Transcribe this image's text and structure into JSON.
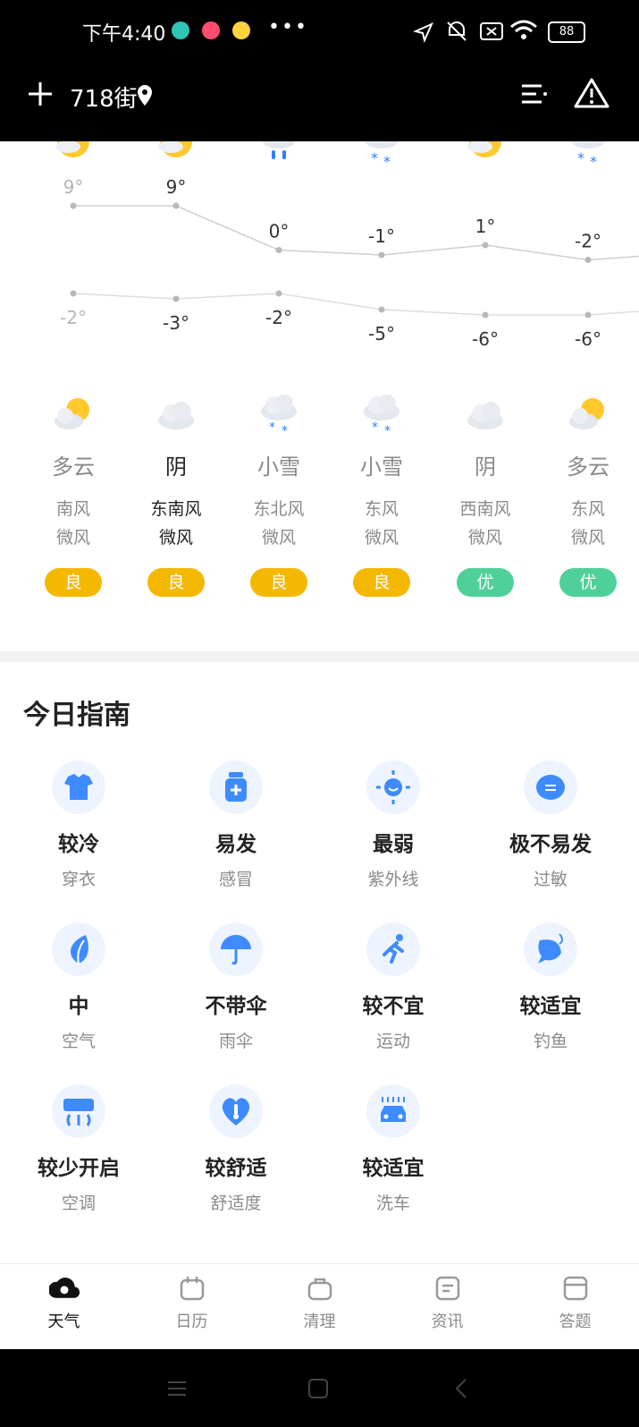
{
  "status_bar": {
    "time": "下午4:40",
    "battery": "88"
  },
  "header": {
    "city": "718街"
  },
  "chart_data": {
    "type": "line",
    "x": [
      "0",
      "1",
      "2",
      "3",
      "4",
      "5"
    ],
    "series": [
      {
        "values": [
          9,
          9,
          0,
          -1,
          1,
          -2
        ]
      },
      {
        "values": [
          -2,
          -3,
          -2,
          -5,
          -6,
          -6
        ]
      }
    ],
    "high_labels": [
      "9°",
      "9°",
      "0°",
      "-1°",
      "1°",
      "-2°"
    ],
    "low_labels": [
      "-2°",
      "-3°",
      "-2°",
      "-5°",
      "-6°",
      "-6°"
    ]
  },
  "days": [
    {
      "icon": "partly-cloudy-icon",
      "cond": "多云",
      "wind_dir": "南风",
      "wind_lvl": "微风",
      "aqi": "良",
      "aqi_color": "#f5b800"
    },
    {
      "icon": "cloudy-icon",
      "cond": "阴",
      "wind_dir": "东南风",
      "wind_lvl": "微风",
      "aqi": "良",
      "aqi_color": "#f5b800"
    },
    {
      "icon": "snow-icon",
      "cond": "小雪",
      "wind_dir": "东北风",
      "wind_lvl": "微风",
      "aqi": "良",
      "aqi_color": "#f5b800"
    },
    {
      "icon": "snow-icon",
      "cond": "小雪",
      "wind_dir": "东风",
      "wind_lvl": "微风",
      "aqi": "良",
      "aqi_color": "#f5b800"
    },
    {
      "icon": "cloudy-icon",
      "cond": "阴",
      "wind_dir": "西南风",
      "wind_lvl": "微风",
      "aqi": "优",
      "aqi_color": "#4fd09a"
    },
    {
      "icon": "partly-cloudy-icon",
      "cond": "多云",
      "wind_dir": "东风",
      "wind_lvl": "微风",
      "aqi": "优",
      "aqi_color": "#4fd09a"
    }
  ],
  "guide": {
    "title": "今日指南",
    "items": [
      {
        "value": "较冷",
        "label": "穿衣",
        "icon": "shirt-icon"
      },
      {
        "value": "易发",
        "label": "感冒",
        "icon": "medicine-icon"
      },
      {
        "value": "最弱",
        "label": "紫外线",
        "icon": "sun-uv-icon"
      },
      {
        "value": "极不易发",
        "label": "过敏",
        "icon": "mask-icon"
      },
      {
        "value": "中",
        "label": "空气",
        "icon": "leaf-icon"
      },
      {
        "value": "不带伞",
        "label": "雨伞",
        "icon": "umbrella-icon"
      },
      {
        "value": "较不宜",
        "label": "运动",
        "icon": "running-icon"
      },
      {
        "value": "较适宜",
        "label": "钓鱼",
        "icon": "fish-icon"
      },
      {
        "value": "较少开启",
        "label": "空调",
        "icon": "air-conditioner-icon"
      },
      {
        "value": "较舒适",
        "label": "舒适度",
        "icon": "heart-thermometer-icon"
      },
      {
        "value": "较适宜",
        "label": "洗车",
        "icon": "car-wash-icon"
      }
    ]
  },
  "tabs": [
    {
      "label": "天气",
      "icon": "weather-icon"
    },
    {
      "label": "日历",
      "icon": "calendar-icon"
    },
    {
      "label": "清理",
      "icon": "clean-icon"
    },
    {
      "label": "资讯",
      "icon": "news-icon"
    },
    {
      "label": "答题",
      "icon": "quiz-icon"
    }
  ]
}
